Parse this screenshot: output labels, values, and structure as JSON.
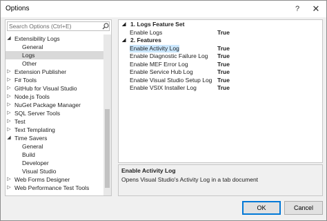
{
  "window": {
    "title": "Options",
    "help_label": "?",
    "close_label": "✕"
  },
  "search": {
    "placeholder": "Search Options (Ctrl+E)"
  },
  "tree": [
    {
      "label": "Extensibility Logs",
      "level": 1,
      "arrow": "◢",
      "selected": false
    },
    {
      "label": "General",
      "level": 2,
      "arrow": "",
      "selected": false
    },
    {
      "label": "Logs",
      "level": 2,
      "arrow": "",
      "selected": true
    },
    {
      "label": "Other",
      "level": 2,
      "arrow": "",
      "selected": false
    },
    {
      "label": "Extension Publisher",
      "level": 1,
      "arrow": "▷",
      "selected": false
    },
    {
      "label": "F# Tools",
      "level": 1,
      "arrow": "▷",
      "selected": false
    },
    {
      "label": "GitHub for Visual Studio",
      "level": 1,
      "arrow": "▷",
      "selected": false
    },
    {
      "label": "Node.js Tools",
      "level": 1,
      "arrow": "▷",
      "selected": false
    },
    {
      "label": "NuGet Package Manager",
      "level": 1,
      "arrow": "▷",
      "selected": false
    },
    {
      "label": "SQL Server Tools",
      "level": 1,
      "arrow": "▷",
      "selected": false
    },
    {
      "label": "Test",
      "level": 1,
      "arrow": "▷",
      "selected": false
    },
    {
      "label": "Text Templating",
      "level": 1,
      "arrow": "▷",
      "selected": false
    },
    {
      "label": "Time Savers",
      "level": 1,
      "arrow": "◢",
      "selected": false
    },
    {
      "label": "General",
      "level": 2,
      "arrow": "",
      "selected": false
    },
    {
      "label": "Build",
      "level": 2,
      "arrow": "",
      "selected": false
    },
    {
      "label": "Developer",
      "level": 2,
      "arrow": "",
      "selected": false
    },
    {
      "label": "Visual Studio",
      "level": 2,
      "arrow": "",
      "selected": false
    },
    {
      "label": "Web Forms Designer",
      "level": 1,
      "arrow": "▷",
      "selected": false
    },
    {
      "label": "Web Performance Test Tools",
      "level": 1,
      "arrow": "▷",
      "selected": false
    }
  ],
  "grid": [
    {
      "type": "category",
      "arrow": "◢",
      "label": "1. Logs Feature Set"
    },
    {
      "type": "property",
      "name": "Enable Logs",
      "value": "True",
      "selected": false
    },
    {
      "type": "category",
      "arrow": "◢",
      "label": "2. Features"
    },
    {
      "type": "property",
      "name": "Enable Activity Log",
      "value": "True",
      "selected": true
    },
    {
      "type": "property",
      "name": "Enable Diagnostic Failure Log",
      "value": "True",
      "selected": false
    },
    {
      "type": "property",
      "name": "Enable MEF Error Log",
      "value": "True",
      "selected": false
    },
    {
      "type": "property",
      "name": "Enable Service Hub Log",
      "value": "True",
      "selected": false
    },
    {
      "type": "property",
      "name": "Enable Visual Studio Setup Log",
      "value": "True",
      "selected": false
    },
    {
      "type": "property",
      "name": "Enable VSIX Installer Log",
      "value": "True",
      "selected": false
    }
  ],
  "description": {
    "title": "Enable Activity Log",
    "text": "Opens Visual Studio's Activity Log in a tab document"
  },
  "buttons": {
    "ok": "OK",
    "cancel": "Cancel"
  },
  "colors": {
    "selection": "#cce8ff",
    "tree_selection": "#d9d9d9",
    "accent": "#0078d7"
  }
}
